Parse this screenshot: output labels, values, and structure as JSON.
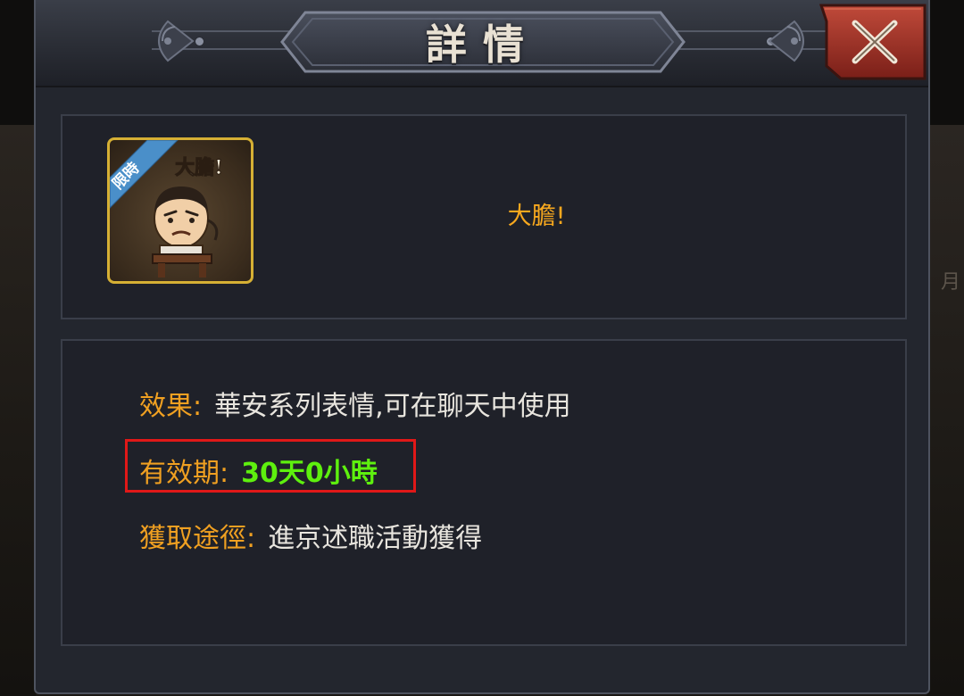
{
  "dialog": {
    "title": "詳情",
    "close_icon": "close-x-icon"
  },
  "item": {
    "icon": "emoji-sticker-icon",
    "badge": "限時",
    "sticker_text": "大膽!",
    "name": "大膽!"
  },
  "details": {
    "effect_label": "效果:",
    "effect_value": "華安系列表情,可在聊天中使用",
    "validity_label": "有效期:",
    "validity_value": "30天0小時",
    "source_label": "獲取途徑:",
    "source_value": "進京述職活動獲得"
  },
  "colors": {
    "label": "#f0a021",
    "value": "#e8e5de",
    "validity_value": "#5ef00e",
    "item_name": "#f7a81e",
    "highlight_border": "#e01818",
    "frame_gold": "#d6b034",
    "close_button": "#a8382c"
  }
}
